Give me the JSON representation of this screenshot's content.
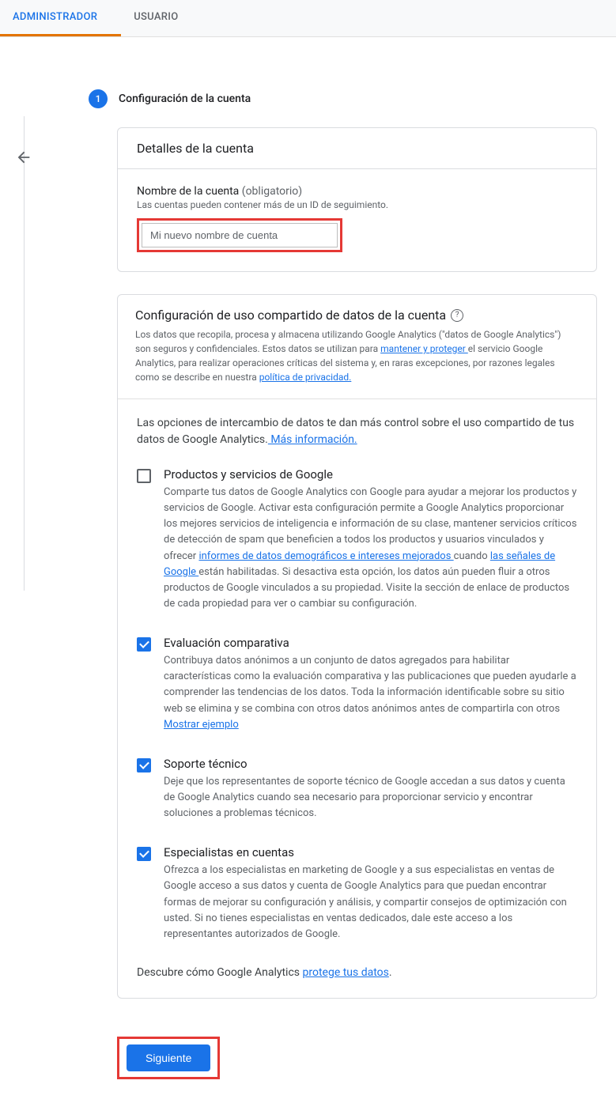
{
  "tabs": {
    "admin": "ADMINISTRADOR",
    "user": "USUARIO"
  },
  "step": {
    "number": "1",
    "title": "Configuración de la cuenta"
  },
  "account_details": {
    "header": "Detalles de la cuenta",
    "name_label": "Nombre de la cuenta ",
    "name_hint": "(obligatorio)",
    "helper": "Las cuentas pueden contener más de un ID de seguimiento.",
    "input_value": "Mi nuevo nombre de cuenta"
  },
  "sharing": {
    "title": "Configuración de uso compartido de datos de la cuenta ",
    "desc_1": "Los datos que recopila, procesa y almacena utilizando Google Analytics (\"datos de Google Analytics\") son seguros y confidenciales. Estos datos se utilizan para ",
    "link_maintain": "mantener y proteger ",
    "desc_2": "el servicio Google Analytics, para realizar operaciones críticas del sistema y, en raras excepciones, por razones legales como se describe en nuestra ",
    "link_privacy": "política de privacidad.",
    "intro": "Las opciones de intercambio de datos te dan más control sobre el uso compartido de tus datos de Google Analytics.",
    "link_more_info": " Más información.",
    "options": [
      {
        "checked": false,
        "title": "Productos y servicios de Google",
        "desc_1": "Comparte tus datos de Google Analytics con Google para ayudar a mejorar los productos y servicios de Google. Activar esta configuración permite a Google Analytics proporcionar los mejores servicios de inteligencia e información de su clase, mantener servicios críticos de detección de spam que beneficien a todos los productos y usuarios vinculados y ofrecer ",
        "link_1": "informes de datos demográficos e intereses mejorados ",
        "desc_2": "cuando ",
        "link_2": "las señales de Google ",
        "desc_3": "están habilitadas. Si desactiva esta opción, los datos aún pueden fluir a otros productos de Google vinculados a su propiedad. Visite la sección de enlace de productos de cada propiedad para ver o cambiar su configuración."
      },
      {
        "checked": true,
        "title": "Evaluación comparativa",
        "desc_1": "Contribuya datos anónimos a un conjunto de datos agregados para habilitar características como la evaluación comparativa y las publicaciones que pueden ayudarle a comprender las tendencias de los datos. Toda la información identificable sobre su sitio web se elimina y se combina con otros datos anónimos antes de compartirla con otros  ",
        "link_1": "Mostrar ejemplo"
      },
      {
        "checked": true,
        "title": "Soporte técnico",
        "desc_1": "Deje que los representantes de soporte técnico de Google accedan a sus datos y cuenta de Google Analytics cuando sea necesario para proporcionar servicio y encontrar soluciones a problemas técnicos."
      },
      {
        "checked": true,
        "title": "Especialistas en cuentas",
        "desc_1": "Ofrezca a los especialistas en marketing de Google y a sus especialistas en ventas de Google acceso a sus datos y cuenta de Google Analytics para que puedan encontrar formas de mejorar su configuración y análisis, y compartir consejos de optimización con usted. Si no tienes especialistas en ventas dedicados, dale este acceso a los representantes autorizados de Google."
      }
    ],
    "footer_1": "Descubre cómo Google Analytics ",
    "footer_link": "protege tus datos",
    "footer_2": "."
  },
  "next_button": "Siguiente"
}
